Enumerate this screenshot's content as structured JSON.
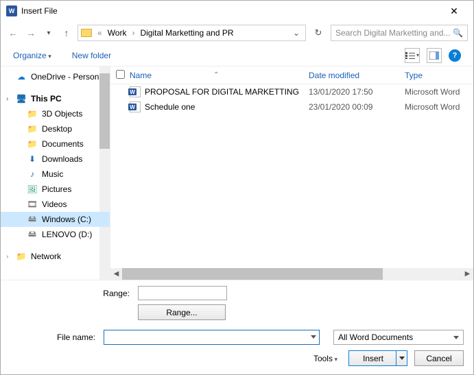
{
  "window": {
    "title": "Insert File"
  },
  "breadcrumb": {
    "prefix": "«",
    "items": [
      "Work",
      "Digital Marketting and PR"
    ]
  },
  "search": {
    "placeholder": "Search Digital Marketting and..."
  },
  "toolbar": {
    "organize": "Organize",
    "newfolder": "New folder"
  },
  "columns": {
    "name": "Name",
    "date": "Date modified",
    "type": "Type"
  },
  "sidebar": {
    "items": [
      {
        "label": "OneDrive - Person",
        "icon": "onedrive",
        "level": 1
      },
      {
        "label": "This PC",
        "icon": "pc",
        "level": 1,
        "bold": true,
        "expandable": true
      },
      {
        "label": "3D Objects",
        "icon": "generic",
        "level": 2
      },
      {
        "label": "Desktop",
        "icon": "generic",
        "level": 2
      },
      {
        "label": "Documents",
        "icon": "generic",
        "level": 2
      },
      {
        "label": "Downloads",
        "icon": "dl",
        "level": 2
      },
      {
        "label": "Music",
        "icon": "music",
        "level": 2
      },
      {
        "label": "Pictures",
        "icon": "pic",
        "level": 2
      },
      {
        "label": "Videos",
        "icon": "vid",
        "level": 2
      },
      {
        "label": "Windows (C:)",
        "icon": "drive",
        "level": 2,
        "selected": true
      },
      {
        "label": "LENOVO (D:)",
        "icon": "drive",
        "level": 2
      },
      {
        "label": "Network",
        "icon": "generic",
        "level": 1,
        "expandable": true
      }
    ]
  },
  "files": [
    {
      "name": "PROPOSAL FOR DIGITAL MARKETTING",
      "date": "13/01/2020 17:50",
      "type": "Microsoft Word"
    },
    {
      "name": "Schedule one",
      "date": "23/01/2020 00:09",
      "type": "Microsoft Word"
    }
  ],
  "range": {
    "label": "Range:",
    "button": "Range..."
  },
  "filename": {
    "label": "File name:"
  },
  "filter": {
    "label": "All Word Documents"
  },
  "actions": {
    "tools": "Tools",
    "insert": "Insert",
    "cancel": "Cancel"
  }
}
